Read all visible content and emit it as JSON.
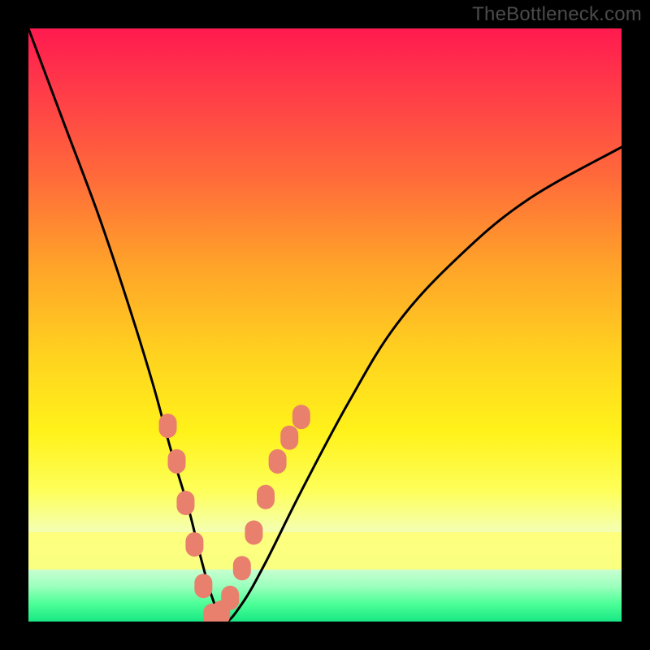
{
  "watermark": "TheBottleneck.com",
  "chart_data": {
    "type": "line",
    "title": "",
    "xlabel": "",
    "ylabel": "",
    "xlim": [
      0,
      100
    ],
    "ylim": [
      0,
      100
    ],
    "series": [
      {
        "name": "bottleneck-curve",
        "x": [
          0,
          6,
          12,
          17,
          21,
          24,
          27,
          29,
          31,
          33,
          36,
          40,
          46,
          54,
          62,
          72,
          84,
          100
        ],
        "values": [
          100,
          84,
          68,
          53,
          40,
          29,
          19,
          11,
          4,
          0,
          3,
          10,
          22,
          37,
          50,
          61,
          71,
          80
        ]
      }
    ],
    "markers": {
      "name": "salmon-dots",
      "x": [
        23.5,
        25.0,
        26.5,
        28.0,
        29.5,
        31.0,
        32.5,
        34.0,
        36.0,
        38.0,
        40.0,
        42.0,
        44.0,
        46.0
      ],
      "values": [
        33.0,
        27.0,
        20.0,
        13.0,
        6.0,
        1.0,
        1.5,
        4.0,
        9.0,
        15.0,
        21.0,
        27.0,
        31.0,
        34.5
      ]
    },
    "gradient_stops": [
      {
        "pos": 0,
        "color": "#ff1a4f"
      },
      {
        "pos": 25,
        "color": "#ff6a3a"
      },
      {
        "pos": 55,
        "color": "#ffd21f"
      },
      {
        "pos": 78,
        "color": "#feff5a"
      },
      {
        "pos": 100,
        "color": "#17e884"
      }
    ]
  }
}
